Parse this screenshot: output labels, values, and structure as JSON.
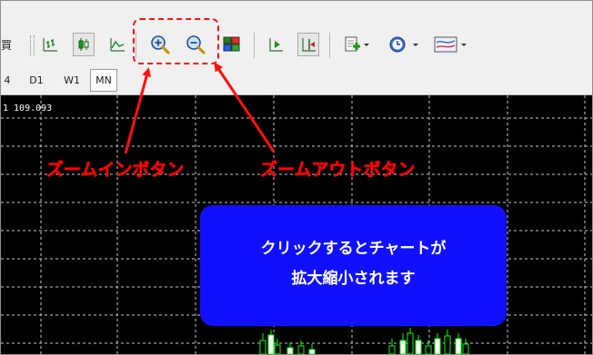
{
  "toolbar": {
    "cut_char": "買",
    "icons": [
      "bar-chart-icon",
      "candlestick-icon",
      "line-chart-icon",
      "zoom-in-icon",
      "zoom-out-icon",
      "tile-windows-icon",
      "autoscroll-icon",
      "chart-shift-icon",
      "indicators-icon",
      "periods-icon",
      "templates-icon"
    ]
  },
  "timeframes": {
    "cut_label": "4",
    "items": [
      "D1",
      "W1",
      "MN"
    ],
    "active": "MN"
  },
  "chart": {
    "price_text": "1 109.093",
    "background": "#000000",
    "grid_color": "#c8c8c8",
    "candle_color": "#00ff00"
  },
  "annotations": {
    "zoom_in_label": "ズームインボタン",
    "zoom_out_label": "ズームアウトボタン",
    "callout_line1": "クリックするとチャートが",
    "callout_line2": "拡大縮小されます",
    "arrow_color": "#ff1010",
    "callout_color": "#1010ff"
  }
}
